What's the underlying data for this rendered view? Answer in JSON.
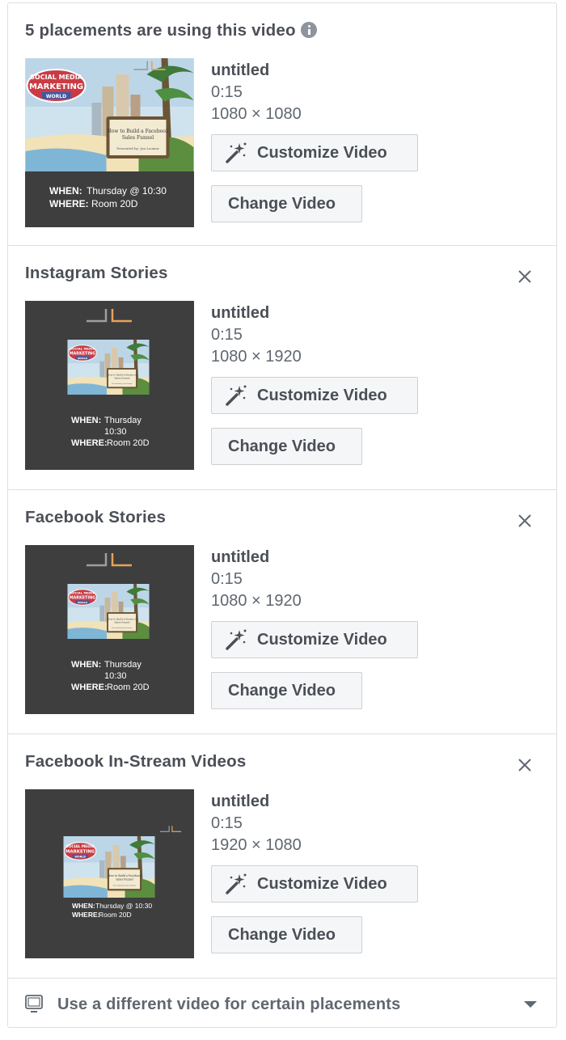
{
  "header": {
    "title": "5 placements are using this video",
    "icon": "info-icon"
  },
  "placements": [
    {
      "title": "",
      "video": {
        "name": "untitled",
        "duration": "0:15",
        "dimensions": "1080 × 1080"
      },
      "thumb": {
        "when_label": "WHEN:",
        "when": "Thursday @ 10:30",
        "where_label": "WHERE:",
        "where": "Room 20D",
        "logo_top": "SOCIAL MEDIA",
        "logo_mid": "MARKETING",
        "logo_bot": "WORLD",
        "card_line1": "How to Build a Facebook",
        "card_line2": "Sales Funnel",
        "card_line3": "Presented by: Jon Loomer"
      }
    },
    {
      "title": "Instagram Stories",
      "video": {
        "name": "untitled",
        "duration": "0:15",
        "dimensions": "1080 × 1920"
      },
      "thumb": {
        "when_label": "WHEN:",
        "when": "Thursday",
        "when2": "10:30",
        "where_label": "WHERE:",
        "where": "Room 20D"
      }
    },
    {
      "title": "Facebook Stories",
      "video": {
        "name": "untitled",
        "duration": "0:15",
        "dimensions": "1080 × 1920"
      },
      "thumb": {
        "when_label": "WHEN:",
        "when": "Thursday",
        "when2": "10:30",
        "where_label": "WHERE:",
        "where": "Room 20D"
      }
    },
    {
      "title": "Facebook In-Stream Videos",
      "video": {
        "name": "untitled",
        "duration": "0:15",
        "dimensions": "1920 × 1080"
      },
      "thumb": {
        "when_label": "WHEN:",
        "when": "Thursday @ 10:30",
        "where_label": "WHERE:",
        "where": "Room 20D"
      }
    }
  ],
  "buttons": {
    "customize": "Customize Video",
    "change": "Change Video"
  },
  "footer": {
    "label": "Use a different video for certain placements",
    "icon": "monitor-icon",
    "dropdown_icon": "caret-down-icon"
  },
  "colors": {
    "border": "#dddfe2",
    "button_bg": "#f5f6f7",
    "text_dark": "#4b4f56",
    "text_muted": "#606770",
    "thumb_bg": "#3e3e3e",
    "logo_orange": "#e8a25a"
  }
}
